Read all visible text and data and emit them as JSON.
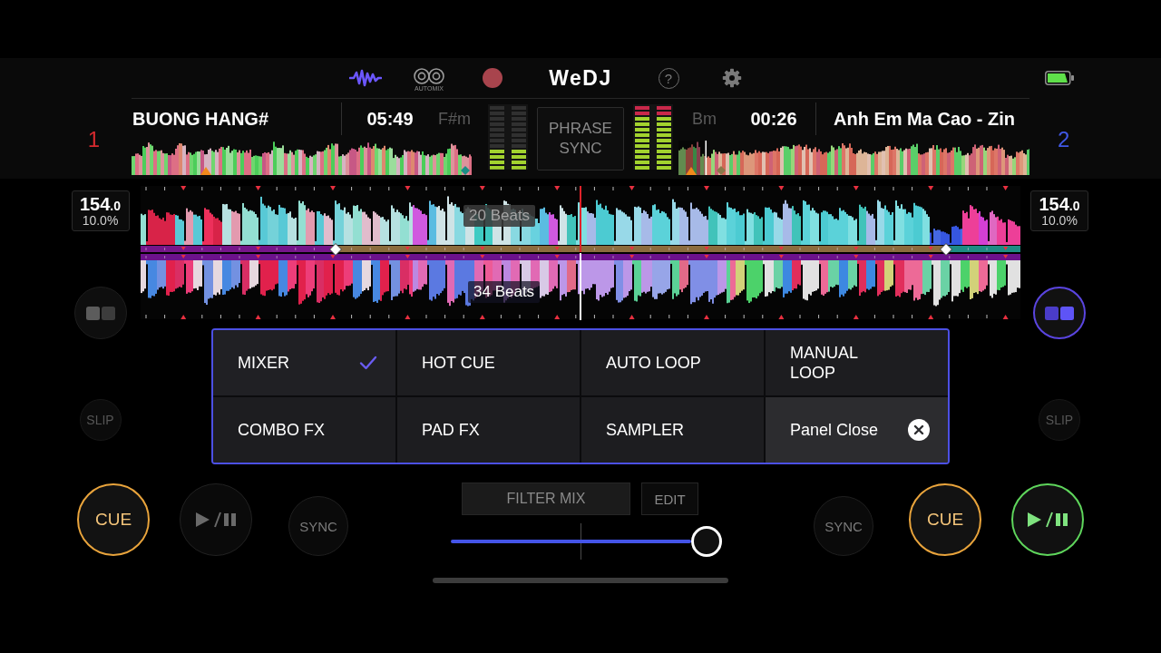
{
  "toolbar": {
    "automix_label": "AUTOMIX",
    "logo": "WeDJ",
    "help": "?"
  },
  "phrase_sync": "PHRASE SYNC",
  "decks": [
    {
      "number": "1",
      "color": "#d62a2e",
      "title": "BUONG HANG#",
      "time": "05:49",
      "key": "F#m",
      "meters": [
        {
          "level": 0.33
        },
        {
          "level": 0.33
        }
      ],
      "bpm": "154",
      "bpm_fraction": ".0",
      "pitch": "10.0%",
      "beat_countdown": {
        "text": "20 Beats",
        "dimmed": true
      },
      "layout_toggle": {
        "selected": false
      },
      "slip": {
        "label": "SLIP",
        "on": false
      },
      "cue": "CUE",
      "playing": false,
      "sync": {
        "label": "SYNC",
        "on": false
      }
    },
    {
      "number": "2",
      "color": "#4058e6",
      "title": "Anh Em Ma Cao - Zin",
      "time": "00:26",
      "key": "Bm",
      "meters": [
        {
          "level": 1
        },
        {
          "level": 1
        }
      ],
      "bpm": "154",
      "bpm_fraction": ".0",
      "pitch": "10.0%",
      "beat_countdown": {
        "text": "34 Beats",
        "dimmed": false
      },
      "layout_toggle": {
        "selected": true
      },
      "slip": {
        "label": "SLIP",
        "on": false
      },
      "cue": "CUE",
      "playing": true,
      "sync": {
        "label": "SYNC",
        "on": false
      }
    }
  ],
  "panel": {
    "items": [
      {
        "label": "MIXER",
        "kind": "tab",
        "selected": true
      },
      {
        "label": "HOT CUE",
        "kind": "tab",
        "selected": false
      },
      {
        "label": "AUTO LOOP",
        "kind": "tab",
        "selected": false
      },
      {
        "label": "MANUAL LOOP",
        "kind": "tab",
        "selected": false
      },
      {
        "label": "COMBO FX",
        "kind": "tab",
        "selected": false
      },
      {
        "label": "PAD FX",
        "kind": "tab",
        "selected": false
      },
      {
        "label": "SAMPLER",
        "kind": "tab",
        "selected": false
      },
      {
        "label": "Panel Close",
        "kind": "close",
        "selected": false
      }
    ]
  },
  "mixer": {
    "fx": "FILTER MIX",
    "edit": "EDIT",
    "crossfader": {
      "level": 1
    }
  }
}
